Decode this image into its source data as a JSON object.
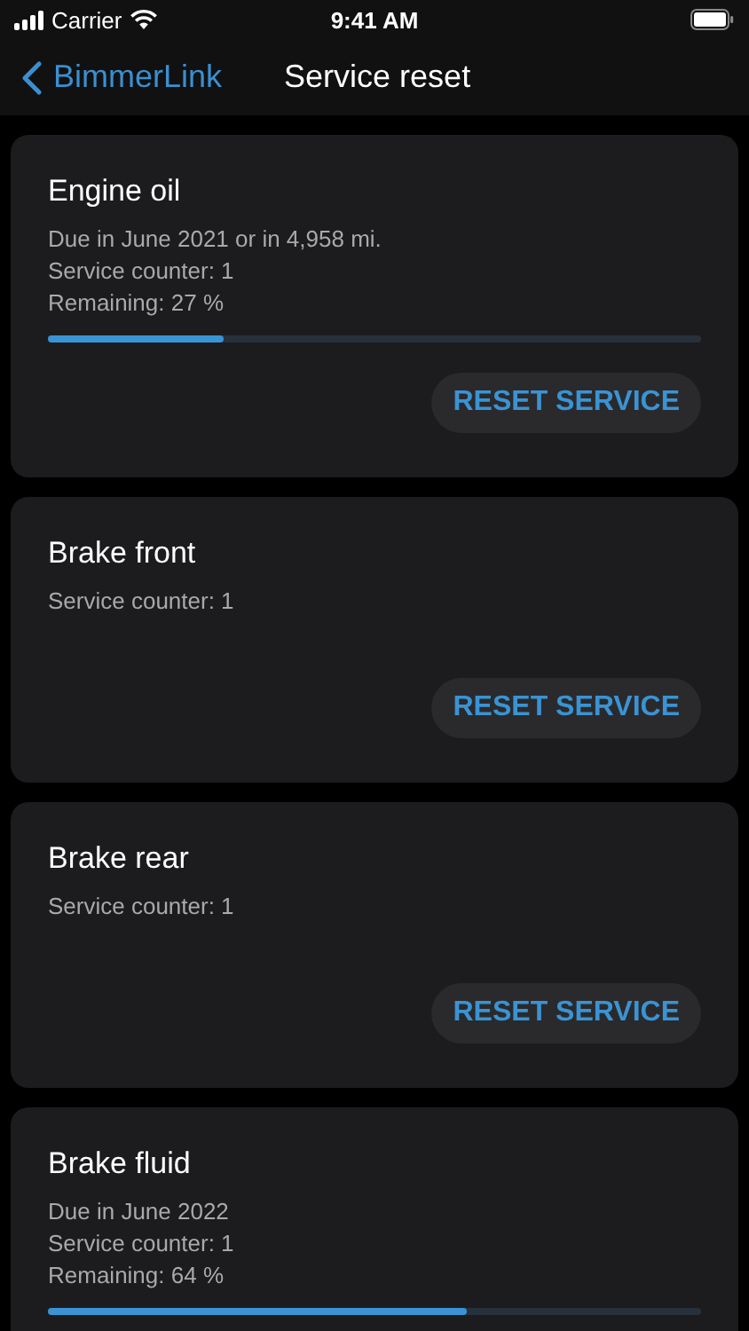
{
  "status_bar": {
    "carrier": "Carrier",
    "time": "9:41 AM"
  },
  "nav": {
    "back_label": "BimmerLink",
    "title": "Service reset"
  },
  "cards": [
    {
      "title": "Engine oil",
      "lines": [
        "Due in June 2021 or in 4,958 mi.",
        "Service counter: 1",
        "Remaining: 27 %"
      ],
      "level": 0.27,
      "button": "RESET SERVICE"
    },
    {
      "title": "Brake front",
      "lines": [
        "Service counter: 1"
      ],
      "button": "RESET SERVICE"
    },
    {
      "title": "Brake rear",
      "lines": [
        "Service counter: 1"
      ],
      "button": "RESET SERVICE"
    },
    {
      "title": "Brake fluid",
      "lines": [
        "Due in June 2022",
        "Service counter: 1",
        "Remaining: 64 %"
      ],
      "level": 0.64
    }
  ]
}
